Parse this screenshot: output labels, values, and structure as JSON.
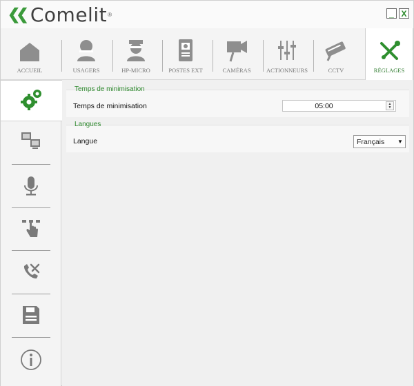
{
  "app": {
    "brand": "Comelit",
    "minimize": "_",
    "close": "X"
  },
  "tabs": [
    {
      "label": "ACCUEIL",
      "icon": "home-icon"
    },
    {
      "label": "USAGERS",
      "icon": "user-icon"
    },
    {
      "label": "HP-MICRO",
      "icon": "officer-icon"
    },
    {
      "label": "POSTES EXT",
      "icon": "intercom-icon"
    },
    {
      "label": "CAMÉRAS",
      "icon": "camera-icon"
    },
    {
      "label": "ACTIONNEURS",
      "icon": "sliders-icon"
    },
    {
      "label": "CCTV",
      "icon": "cctv-icon"
    },
    {
      "label": "RÉGLAGES",
      "icon": "tools-icon",
      "active": true
    }
  ],
  "sidebar": [
    {
      "name": "gears-icon",
      "active": true
    },
    {
      "name": "network-computers-icon"
    },
    {
      "name": "microphone-icon"
    },
    {
      "name": "hand-touch-icon"
    },
    {
      "name": "phone-tools-icon"
    },
    {
      "name": "save-icon"
    },
    {
      "name": "info-icon"
    }
  ],
  "settings": {
    "minimization": {
      "group_title": "Temps de minimisation",
      "label": "Temps de minimisation",
      "value": "05:00"
    },
    "language": {
      "group_title": "Langues",
      "label": "Langue",
      "value": "Français"
    }
  },
  "colors": {
    "accent": "#3b9a3b",
    "icon_grey": "#8a8a8a"
  }
}
